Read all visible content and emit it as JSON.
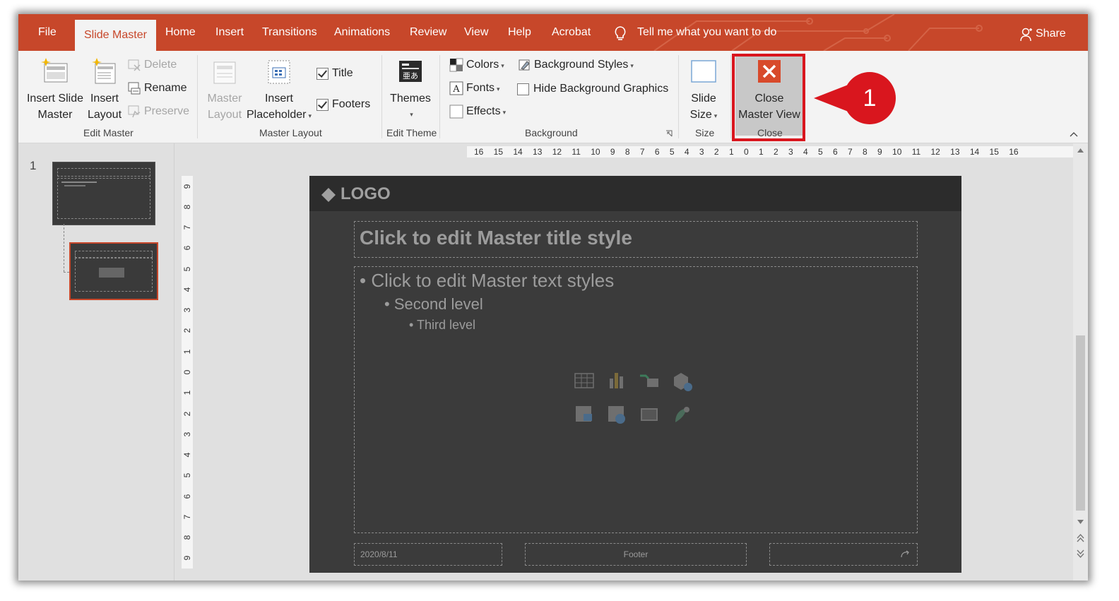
{
  "tabs": [
    "File",
    "Slide Master",
    "Home",
    "Insert",
    "Transitions",
    "Animations",
    "Review",
    "View",
    "Help",
    "Acrobat"
  ],
  "tell_me": "Tell me what you want to do",
  "share": "Share",
  "ribbon": {
    "edit_master": {
      "label": "Edit Master",
      "insert_slide_master": [
        "Insert Slide",
        "Master"
      ],
      "insert_layout": [
        "Insert",
        "Layout"
      ],
      "delete": "Delete",
      "rename": "Rename",
      "preserve": "Preserve"
    },
    "master_layout": {
      "label": "Master Layout",
      "master_layout_btn": [
        "Master",
        "Layout"
      ],
      "insert_placeholder": [
        "Insert",
        "Placeholder"
      ],
      "title_check": "Title",
      "footers_check": "Footers"
    },
    "edit_theme": {
      "label": "Edit Theme",
      "themes": "Themes"
    },
    "background": {
      "label": "Background",
      "colors": "Colors",
      "fonts": "Fonts",
      "effects": "Effects",
      "background_styles": "Background Styles",
      "hide_background_graphics": "Hide Background Graphics"
    },
    "size": {
      "label": "Size",
      "slide_size": [
        "Slide",
        "Size"
      ]
    },
    "close": {
      "label": "Close",
      "close_master_view": [
        "Close",
        "Master View"
      ]
    }
  },
  "thumbnail_number": "1",
  "ruler_h": "16 15 14 13 12 11 10 9 8 7 6 5 4 3 2 1 0 1 2 3 4 5 6 7 8 9 10 11 12 13 14 15 16",
  "ruler_v": [
    "9",
    "8",
    "7",
    "6",
    "5",
    "4",
    "3",
    "2",
    "1",
    "0",
    "1",
    "2",
    "3",
    "4",
    "5",
    "6",
    "7",
    "8",
    "9"
  ],
  "slide": {
    "logo": "LOGO",
    "title": "Click to edit Master title style",
    "level1": "• Click to edit Master text styles",
    "level2": "• Second level",
    "level3": "• Third level",
    "date": "2020/8/11",
    "footer": "Footer"
  },
  "callout_number": "1",
  "colors": {
    "accent": "#c7472a",
    "callout": "#d9161e"
  }
}
